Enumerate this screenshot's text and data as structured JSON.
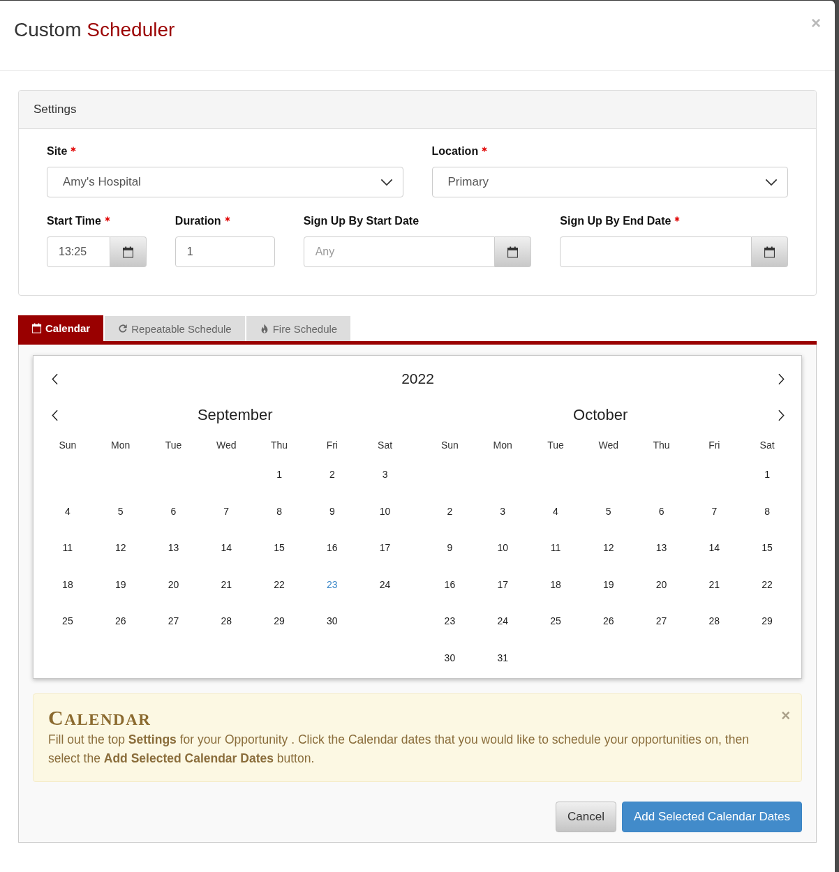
{
  "window": {
    "title": "Custom",
    "title_accent": "Scheduler",
    "close": "×"
  },
  "settings": {
    "heading": "Settings",
    "rows": [
      [
        {
          "kind": "select",
          "label": "Site",
          "required": true,
          "value": "Amy's Hospital"
        },
        {
          "kind": "select",
          "label": "Location",
          "required": true,
          "value": "Primary"
        }
      ],
      [
        {
          "kind": "date",
          "label": "Start Time",
          "required": true,
          "value": "13:25"
        },
        {
          "kind": "text",
          "label": "Duration",
          "required": true,
          "value": "1"
        },
        {
          "kind": "date",
          "label": "Sign Up By Start Date",
          "required": false,
          "placeholder": "Any"
        },
        {
          "kind": "date",
          "label": "Sign Up By End Date",
          "required": true
        }
      ]
    ]
  },
  "tabs": [
    {
      "label": "Calendar",
      "selected": true
    },
    {
      "label": "Repeatable Schedule",
      "selected": false
    },
    {
      "label": "Fire Schedule",
      "selected": false
    }
  ],
  "calendar": {
    "year": "2022",
    "months": [
      {
        "name": "September",
        "weekdays": [
          "Sun",
          "Mon",
          "Tue",
          "Wed",
          "Thu",
          "Fri",
          "Sat"
        ],
        "weeks": [
          [
            {
              "label": "1",
              "today": false
            },
            {
              "label": "2",
              "today": false
            },
            {
              "label": "3",
              "today": false
            }
          ],
          [
            {
              "label": "4",
              "today": false
            },
            {
              "label": "5",
              "today": false
            },
            {
              "label": "6",
              "today": false
            },
            {
              "label": "7",
              "today": false
            },
            {
              "label": "8",
              "today": false
            },
            {
              "label": "9",
              "today": false
            },
            {
              "label": "10",
              "today": false
            }
          ],
          [
            {
              "label": "11",
              "today": false
            },
            {
              "label": "12",
              "today": false
            },
            {
              "label": "13",
              "today": false
            },
            {
              "label": "14",
              "today": false
            },
            {
              "label": "15",
              "today": false
            },
            {
              "label": "16",
              "today": false
            },
            {
              "label": "17",
              "today": false
            }
          ],
          [
            {
              "label": "18",
              "today": false
            },
            {
              "label": "19",
              "today": false
            },
            {
              "label": "20",
              "today": false
            },
            {
              "label": "21",
              "today": false
            },
            {
              "label": "22",
              "today": false
            },
            {
              "label": "23",
              "today": true
            },
            {
              "label": "24",
              "today": false
            }
          ],
          [
            {
              "label": "25",
              "today": false
            },
            {
              "label": "26",
              "today": false
            },
            {
              "label": "27",
              "today": false
            },
            {
              "label": "28",
              "today": false
            },
            {
              "label": "29",
              "today": false
            },
            {
              "label": "30",
              "today": false
            }
          ]
        ]
      },
      {
        "name": "October",
        "weekdays": [
          "Sun",
          "Mon",
          "Tue",
          "Wed",
          "Thu",
          "Fri",
          "Sat"
        ],
        "weeks": [
          [
            {
              "label": "1",
              "today": false
            }
          ],
          [
            {
              "label": "2",
              "today": false
            },
            {
              "label": "3",
              "today": false
            },
            {
              "label": "4",
              "today": false
            },
            {
              "label": "5",
              "today": false
            },
            {
              "label": "6",
              "today": false
            },
            {
              "label": "7",
              "today": false
            },
            {
              "label": "8",
              "today": false
            }
          ],
          [
            {
              "label": "9",
              "today": false
            },
            {
              "label": "10",
              "today": false
            },
            {
              "label": "11",
              "today": false
            },
            {
              "label": "12",
              "today": false
            },
            {
              "label": "13",
              "today": false
            },
            {
              "label": "14",
              "today": false
            },
            {
              "label": "15",
              "today": false
            }
          ],
          [
            {
              "label": "16",
              "today": false
            },
            {
              "label": "17",
              "today": false
            },
            {
              "label": "18",
              "today": false
            },
            {
              "label": "19",
              "today": false
            },
            {
              "label": "20",
              "today": false
            },
            {
              "label": "21",
              "today": false
            },
            {
              "label": "22",
              "today": false
            }
          ],
          [
            {
              "label": "23",
              "today": false
            },
            {
              "label": "24",
              "today": false
            },
            {
              "label": "25",
              "today": false
            },
            {
              "label": "26",
              "today": false
            },
            {
              "label": "27",
              "today": false
            },
            {
              "label": "28",
              "today": false
            },
            {
              "label": "29",
              "today": false
            }
          ],
          [
            {
              "label": "30",
              "today": false
            },
            {
              "label": "31",
              "today": false
            }
          ]
        ]
      }
    ]
  },
  "alert": {
    "title": "CALENDAR",
    "close": "×",
    "text": "Fill out the top **Settings** for your Opportunity . Click the Calendar dates that you would like to schedule your opportunities on, then select the **Add Selected Calendar Dates** button."
  },
  "buttons": [
    {
      "label": "Cancel",
      "kind": "default"
    },
    {
      "label": "Add Selected Calendar Dates",
      "kind": "primary"
    }
  ]
}
